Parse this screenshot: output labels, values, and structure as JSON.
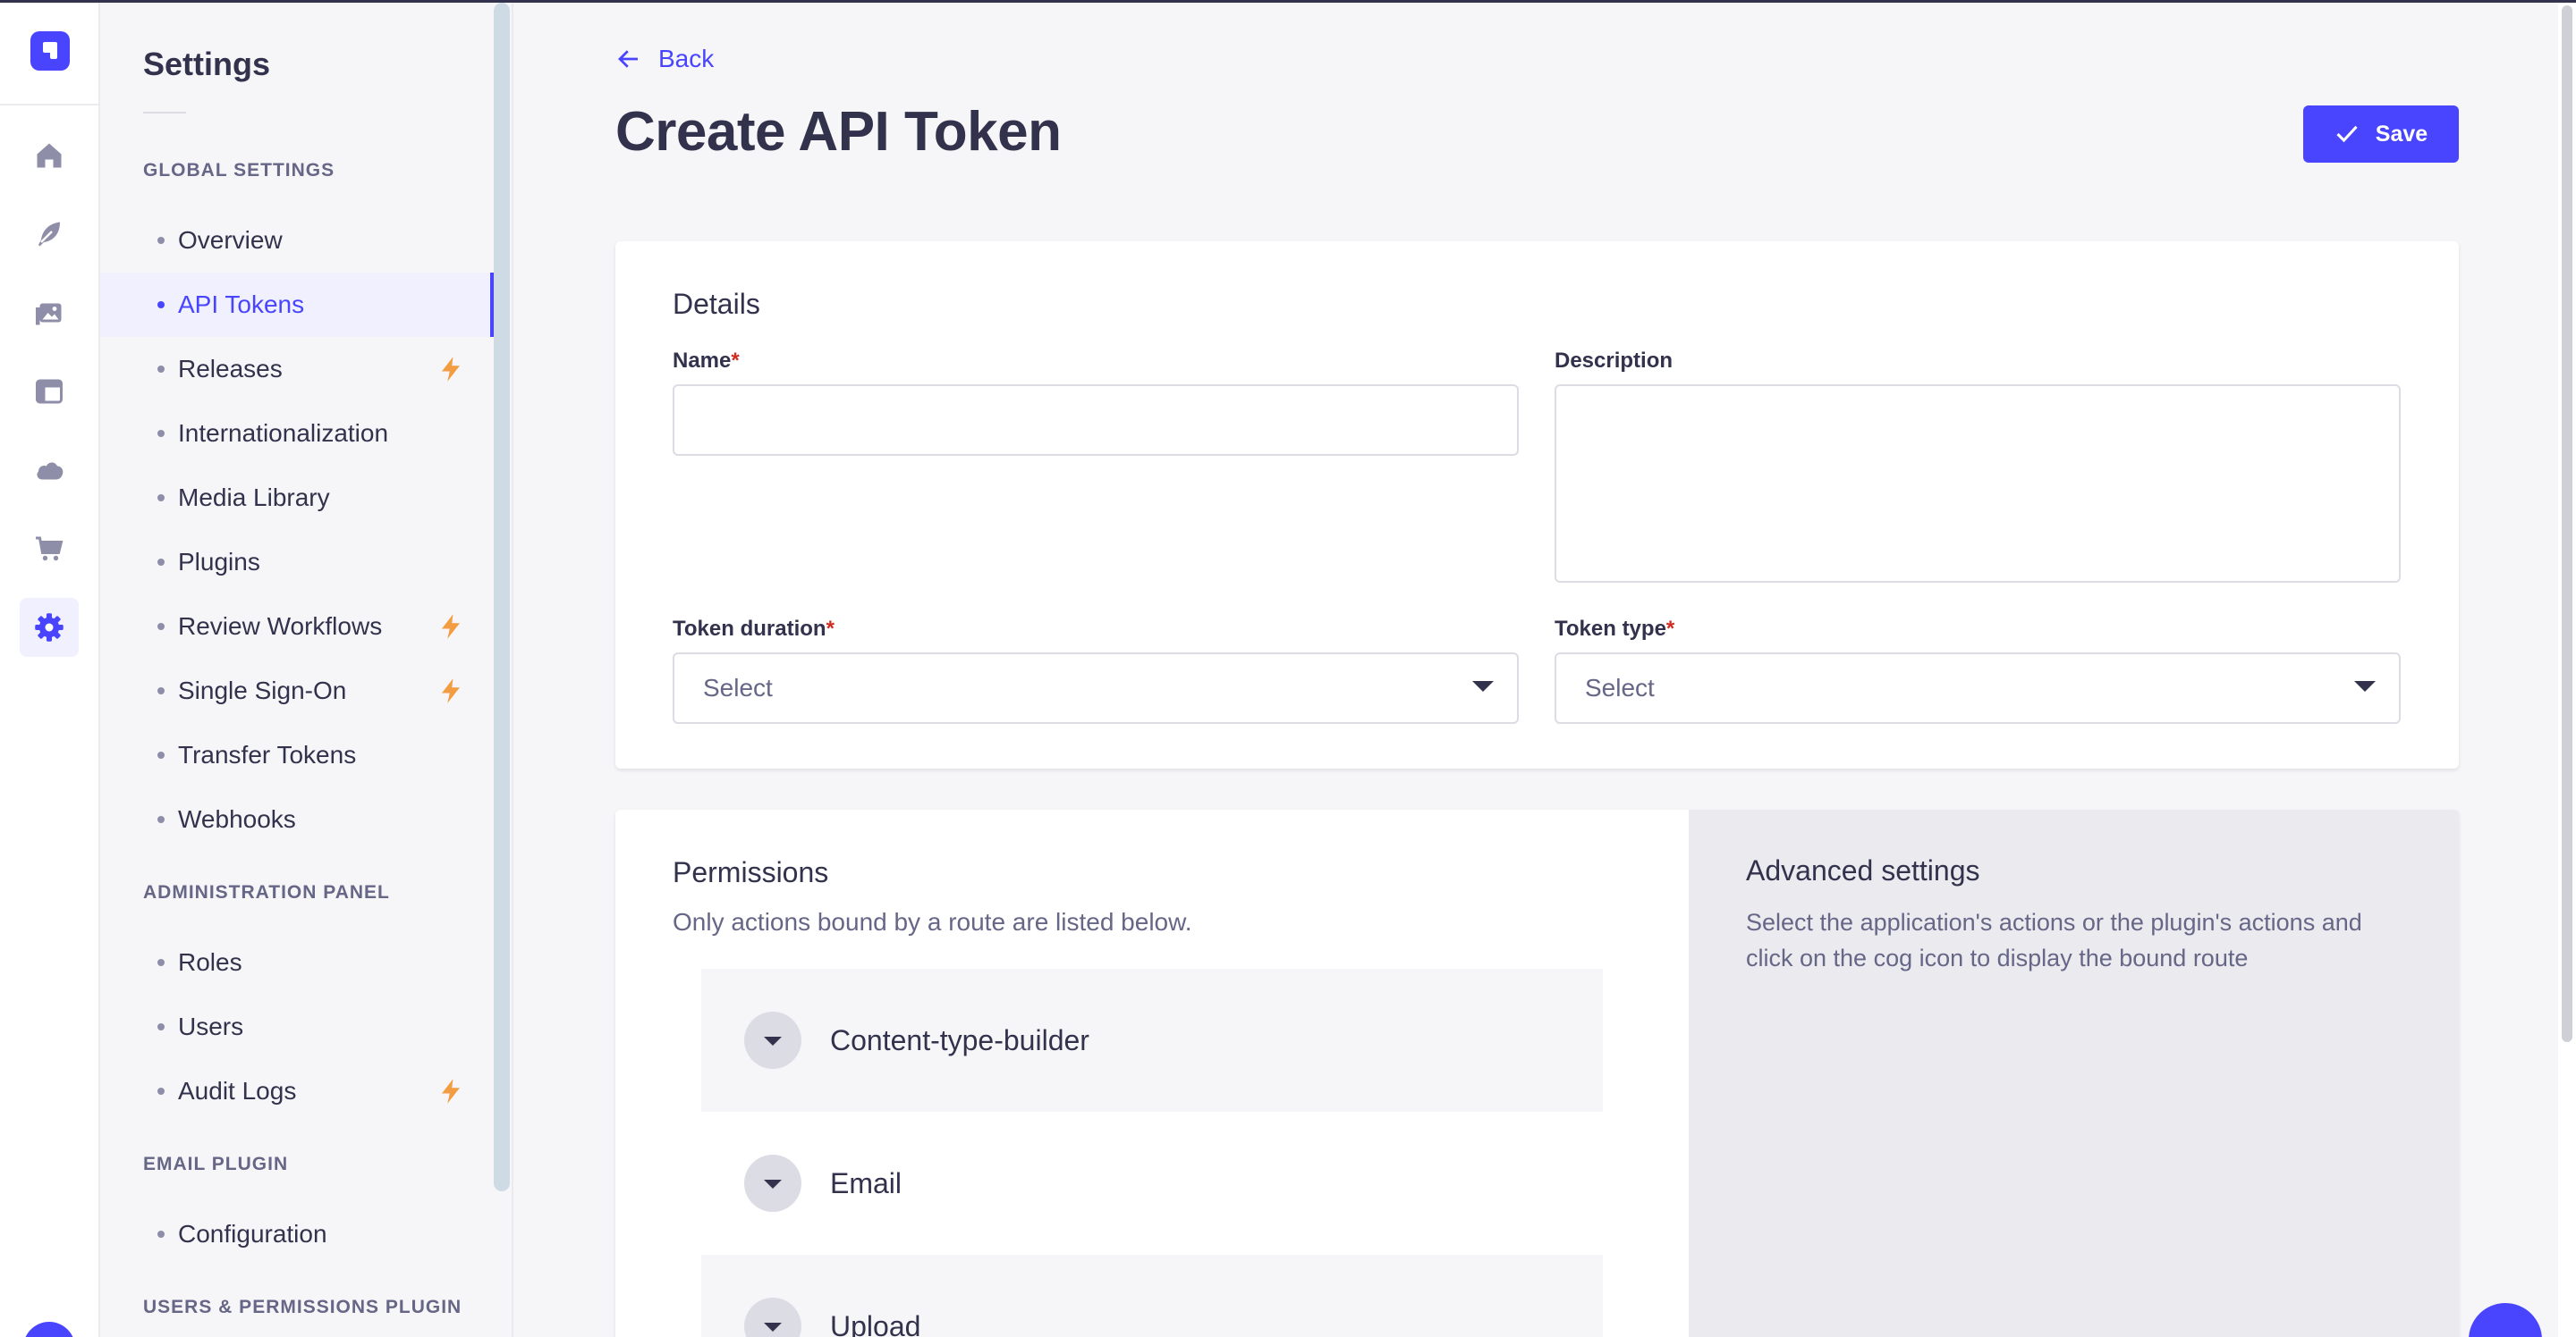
{
  "colors": {
    "primary": "#4945ff",
    "text": "#32324d",
    "muted": "#666687",
    "required": "#d02b20",
    "bolt": "#f29d41"
  },
  "rail": {
    "items": [
      {
        "icon": "home-icon"
      },
      {
        "icon": "feather-icon"
      },
      {
        "icon": "media-icon"
      },
      {
        "icon": "layout-icon"
      },
      {
        "icon": "cloud-icon"
      },
      {
        "icon": "cart-icon"
      },
      {
        "icon": "cog-icon",
        "active": true
      }
    ]
  },
  "subnav": {
    "title": "Settings",
    "global_settings": {
      "label": "GLOBAL SETTINGS",
      "items": [
        {
          "label": "Overview"
        },
        {
          "label": "API Tokens",
          "active": true
        },
        {
          "label": "Releases",
          "bolt": true
        },
        {
          "label": "Internationalization"
        },
        {
          "label": "Media Library"
        },
        {
          "label": "Plugins"
        },
        {
          "label": "Review Workflows",
          "bolt": true
        },
        {
          "label": "Single Sign-On",
          "bolt": true
        },
        {
          "label": "Transfer Tokens"
        },
        {
          "label": "Webhooks"
        }
      ]
    },
    "admin_panel": {
      "label": "ADMINISTRATION PANEL",
      "items": [
        {
          "label": "Roles"
        },
        {
          "label": "Users"
        },
        {
          "label": "Audit Logs",
          "bolt": true
        }
      ]
    },
    "email_plugin": {
      "label": "EMAIL PLUGIN",
      "items": [
        {
          "label": "Configuration"
        }
      ]
    },
    "users_permissions_plugin": {
      "label": "USERS & PERMISSIONS PLUGIN"
    }
  },
  "header": {
    "back_label": "Back",
    "title": "Create API Token",
    "save_label": "Save"
  },
  "details": {
    "title": "Details",
    "name_label": "Name",
    "name_value": "",
    "description_label": "Description",
    "description_value": "",
    "token_duration_label": "Token duration",
    "token_duration_value": "Select",
    "token_type_label": "Token type",
    "token_type_value": "Select",
    "required_mark": "*"
  },
  "permissions": {
    "title": "Permissions",
    "subtitle": "Only actions bound by a route are listed below.",
    "groups": [
      {
        "label": "Content-type-builder"
      },
      {
        "label": "Email"
      },
      {
        "label": "Upload"
      }
    ]
  },
  "advanced": {
    "title": "Advanced settings",
    "text": "Select the application's actions or the plugin's actions and click on the cog icon to display the bound route"
  }
}
